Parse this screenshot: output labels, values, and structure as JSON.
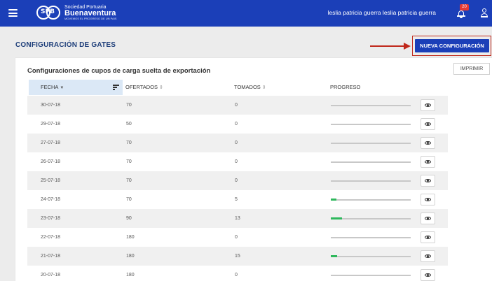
{
  "header": {
    "logo_short": "SPB",
    "logo_line1": "Sociedad Portuaria",
    "logo_line2": "Buenaventura",
    "logo_tagline": "MOVEMOS EL PROGRESO DE UN PAIS",
    "username": "leslia patricia guerra leslia patricia guerra",
    "notification_count": "20"
  },
  "page": {
    "title": "CONFIGURACIÓN DE GATES",
    "new_button": "NUEVA CONFIGURACIÓN",
    "accent_color": "#1b3fb8",
    "annotation_color": "#c0281b"
  },
  "card": {
    "title": "Configuraciones de cupos de carga suelta de exportación",
    "print_button": "IMPRIMIR"
  },
  "table": {
    "columns": {
      "fecha": "FECHA",
      "ofertados": "OFERTADOS",
      "tomados": "TOMADOS",
      "progreso": "PROGRESO"
    },
    "rows": [
      {
        "fecha": "30-07-18",
        "ofertados": "70",
        "tomados": "0",
        "progress": 0
      },
      {
        "fecha": "29-07-18",
        "ofertados": "50",
        "tomados": "0",
        "progress": 0
      },
      {
        "fecha": "27-07-18",
        "ofertados": "70",
        "tomados": "0",
        "progress": 0
      },
      {
        "fecha": "26-07-18",
        "ofertados": "70",
        "tomados": "0",
        "progress": 0
      },
      {
        "fecha": "25-07-18",
        "ofertados": "70",
        "tomados": "0",
        "progress": 0
      },
      {
        "fecha": "24-07-18",
        "ofertados": "70",
        "tomados": "5",
        "progress": 0.07
      },
      {
        "fecha": "23-07-18",
        "ofertados": "90",
        "tomados": "13",
        "progress": 0.14
      },
      {
        "fecha": "22-07-18",
        "ofertados": "180",
        "tomados": "0",
        "progress": 0
      },
      {
        "fecha": "21-07-18",
        "ofertados": "180",
        "tomados": "15",
        "progress": 0.08
      },
      {
        "fecha": "20-07-18",
        "ofertados": "180",
        "tomados": "0",
        "progress": 0
      }
    ]
  }
}
